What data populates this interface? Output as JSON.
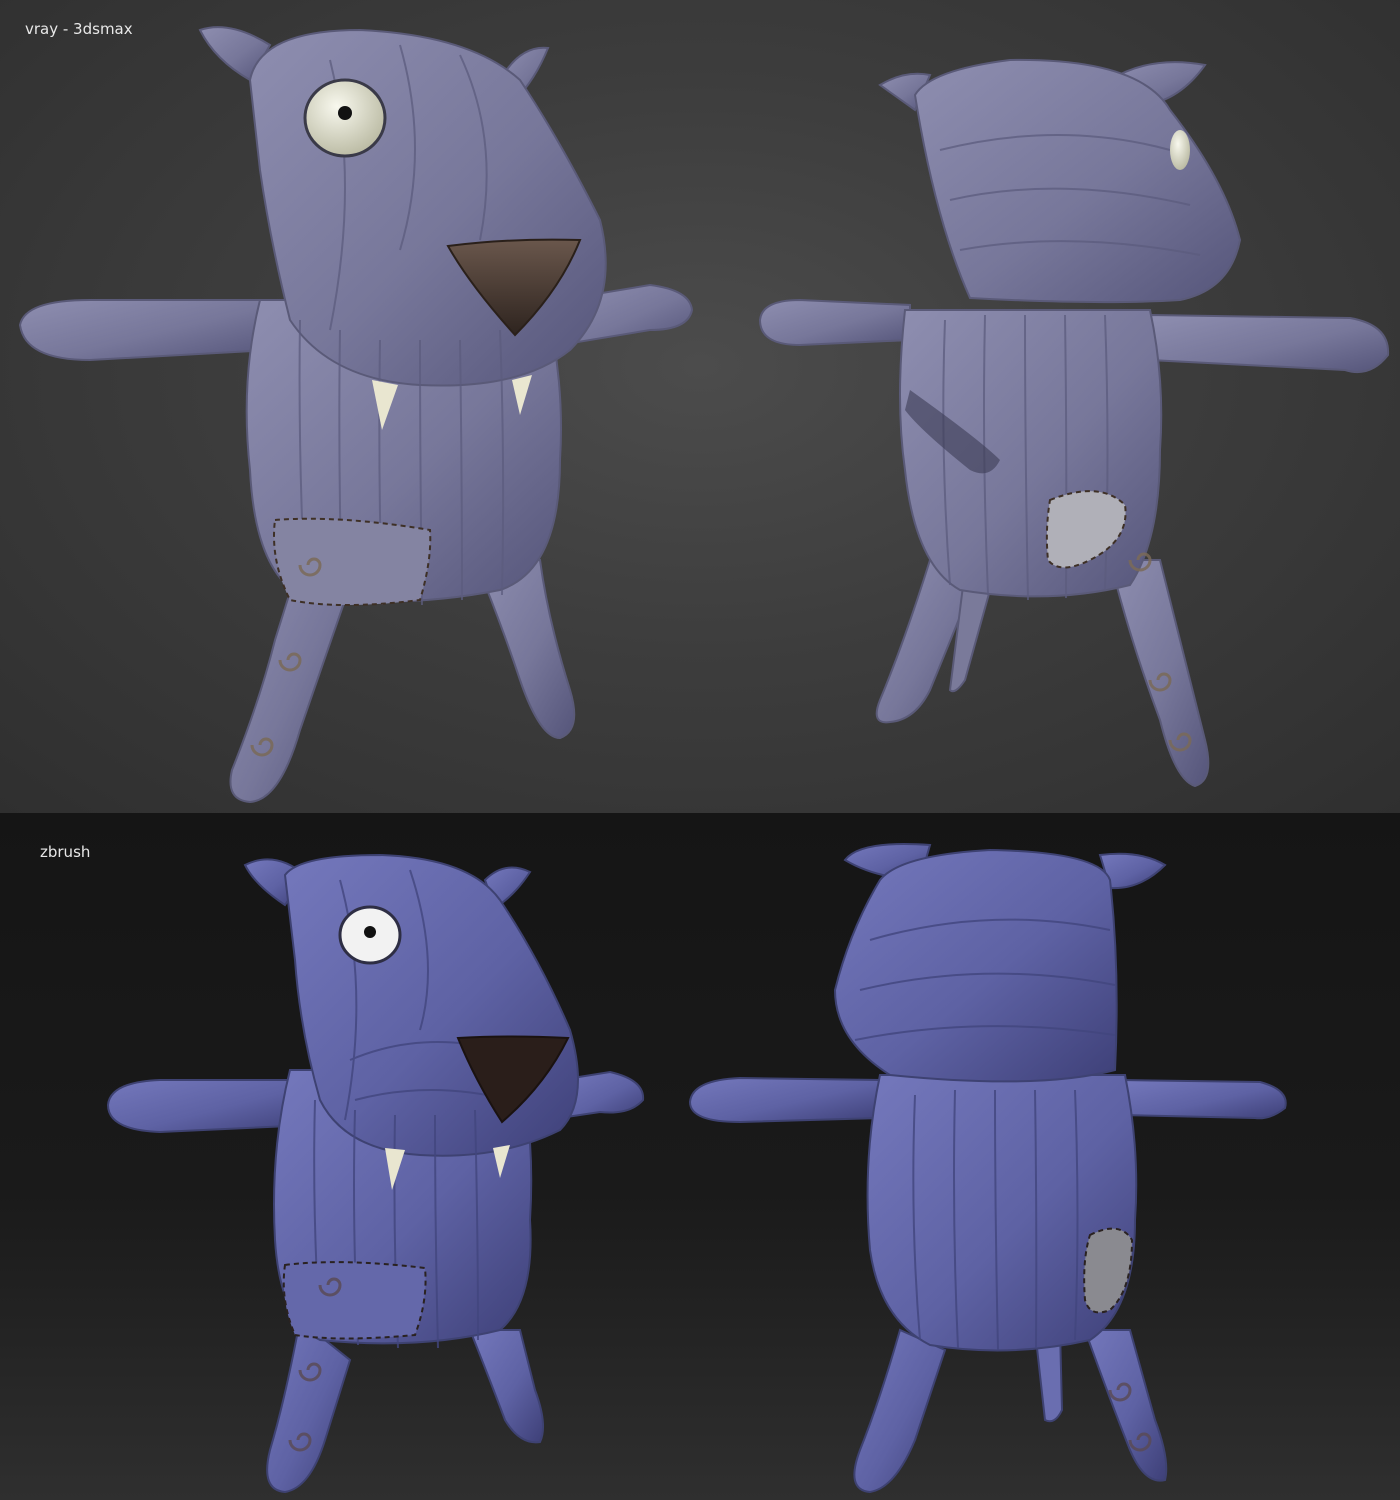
{
  "panels": {
    "top": {
      "label": "vray - 3dsmax"
    },
    "bottom": {
      "label": "zbrush"
    }
  },
  "colors": {
    "vray_background": "#3d3d3d",
    "zbrush_background": "#161616",
    "vray_fabric": "#7a7a9c",
    "zbrush_fabric": "#6266a6",
    "nose": "#4a3a30",
    "fang": "#e9e6d0",
    "eye_white": "#f2f2f2",
    "stitch": "#4a3a30"
  },
  "icons": [
    "plush-cat-front-view",
    "plush-cat-back-view"
  ]
}
